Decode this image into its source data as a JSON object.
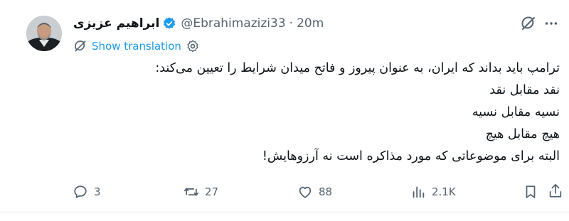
{
  "tweet": {
    "display_name": "ابراهیم عزیزی",
    "handle": "@Ebrahimazizi33",
    "separator": "·",
    "timestamp": "20m",
    "show_translation": "Show translation",
    "lines": [
      "ترامپ باید بداند که ایران، به عنوان پیروز و فاتح میدان شرایط را تعیین می‌کند:",
      "نقد مقابل نقد",
      "نسیه مقابل نسیه",
      "هیچ مقابل هیچ",
      "البته برای موضوعاتی که مورد مذاکره است نه آرزوهایش!"
    ]
  },
  "actions": {
    "replies": "3",
    "reposts": "27",
    "likes": "88",
    "views": "2.1K"
  },
  "icons": {
    "verified": "verified-badge-icon",
    "grok": "grok-icon",
    "more": "more-icon",
    "translate": "translate-icon",
    "settings": "gear-icon",
    "reply": "reply-icon",
    "repost": "repost-icon",
    "like": "heart-icon",
    "views": "views-icon",
    "bookmark": "bookmark-icon",
    "share": "share-icon"
  },
  "colors": {
    "accent": "#1d9bf0",
    "secondary_text": "#536471",
    "primary_text": "#0f1419"
  }
}
